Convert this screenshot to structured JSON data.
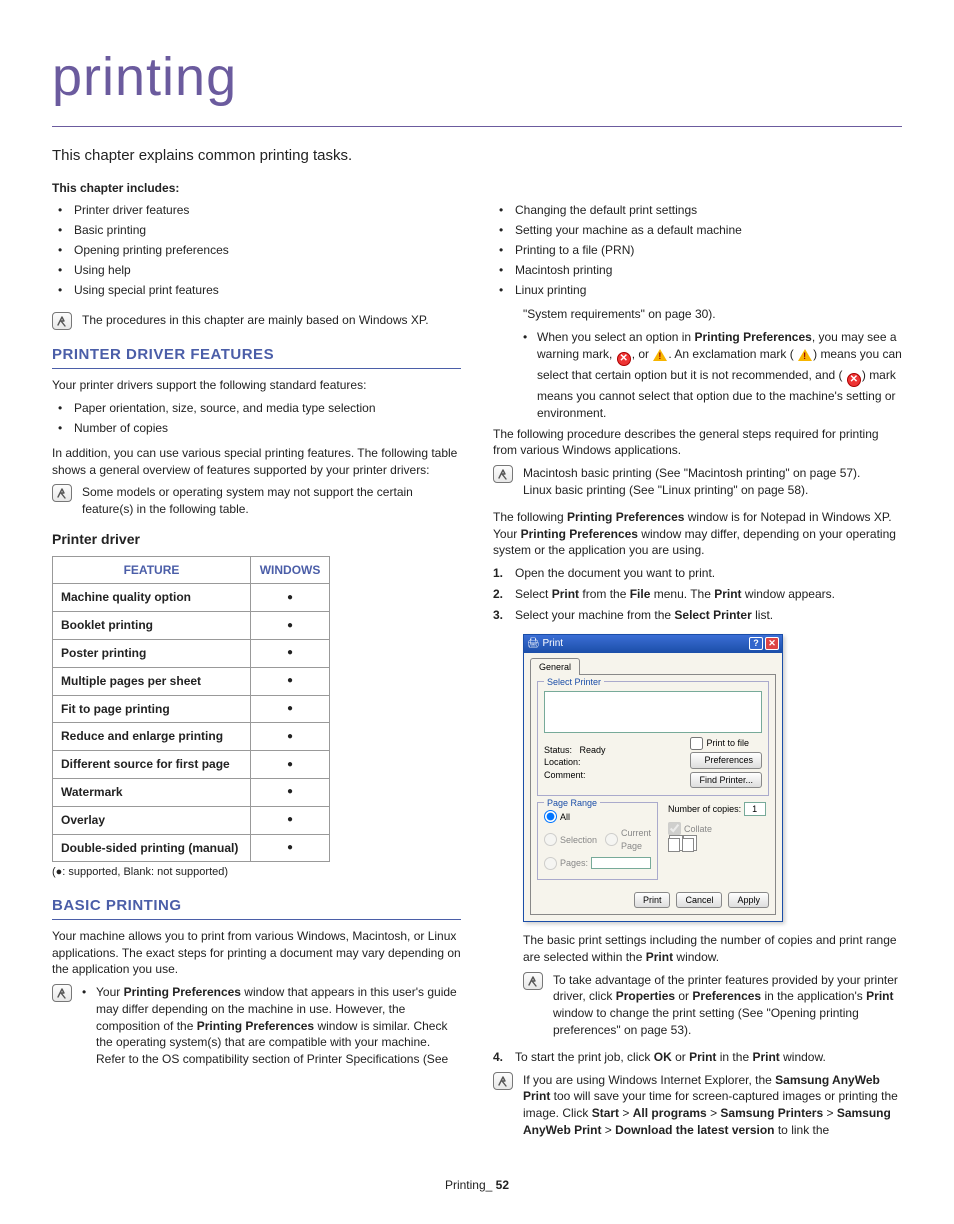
{
  "chapter": {
    "title": "printing",
    "intro": "This chapter explains common printing tasks.",
    "includes_head": "This chapter includes:"
  },
  "includes_left": [
    "Printer driver features",
    "Basic printing",
    "Opening printing preferences",
    "Using help",
    "Using special print features"
  ],
  "includes_right": [
    "Changing the default print settings",
    "Setting your machine as a default machine",
    "Printing to a file (PRN)",
    "Macintosh printing",
    "Linux printing"
  ],
  "note_xp": "The procedures in this chapter are mainly based on Windows XP.",
  "sections": {
    "driver_features": {
      "heading": "PRINTER DRIVER FEATURES",
      "p1": "Your printer drivers support the following standard features:",
      "bullets": [
        "Paper orientation, size, source, and media type selection",
        "Number of copies"
      ],
      "p2": "In addition, you can use various special printing features. The following table shows a general overview of features supported by your printer drivers:",
      "note": "Some models or operating system may not support the certain feature(s) in the following table.",
      "sub_heading": "Printer driver",
      "table": {
        "headers": [
          "FEATURE",
          "WINDOWS"
        ],
        "rows": [
          [
            "Machine quality option",
            "●"
          ],
          [
            "Booklet printing",
            "●"
          ],
          [
            "Poster printing",
            "●"
          ],
          [
            "Multiple pages per sheet",
            "●"
          ],
          [
            "Fit to page printing",
            "●"
          ],
          [
            "Reduce and enlarge printing",
            "●"
          ],
          [
            "Different source for first page",
            "●"
          ],
          [
            "Watermark",
            "●"
          ],
          [
            "Overlay",
            "●"
          ],
          [
            "Double-sided printing (manual)",
            "●"
          ]
        ],
        "note": "(●: supported, Blank: not supported)"
      }
    },
    "basic_printing": {
      "heading": "BASIC PRINTING",
      "p1": "Your machine allows you to print from various Windows, Macintosh, or Linux applications. The exact steps for printing a document may vary depending on the application you use.",
      "note1_parts": {
        "pre": "Your ",
        "b1": "Printing Preferences",
        "mid": " window that appears in this user's guide may differ depending on the machine in use. However, the composition of the ",
        "b2": "Printing Preferences",
        "post": " window is similar. Check the operating system(s) that are compatible with your machine. Refer to the OS compatibility section of Printer Specifications (See"
      },
      "sysreq": "\"System requirements\" on page 30).",
      "warn_parts": {
        "pre": "When you select an option in ",
        "b1": "Printing Preferences",
        "mid1": ", you may see a warning mark, ",
        "mid2": ", or ",
        "mid3": ". An exclamation mark (",
        "mid4": ") means you can select that certain option but it is not recommended, and (",
        "post": ") mark means you cannot select that option due to the machine's setting or environment."
      },
      "p2": "The following procedure describes the general steps required for printing from various Windows applications.",
      "note2_l1": "Macintosh basic printing (See \"Macintosh printing\" on page 57).",
      "note2_l2": "Linux basic printing (See \"Linux printing\" on page 58).",
      "p3_parts": {
        "pre": "The following ",
        "b1": "Printing Preferences",
        "mid": " window is for Notepad in Windows XP. Your ",
        "b2": "Printing Preferences",
        "post": " window may differ, depending on your operating system or the application you are using."
      },
      "steps": [
        {
          "n": "1.",
          "text": "Open the document you want to print."
        },
        {
          "n": "2.",
          "pre": "Select ",
          "b1": "Print",
          "mid1": " from the ",
          "b2": "File",
          "mid2": " menu. The ",
          "b3": "Print",
          "post": " window appears."
        },
        {
          "n": "3.",
          "pre": "Select your machine from the ",
          "b1": "Select Printer",
          "post": " list."
        }
      ],
      "p4_parts": {
        "pre": "The basic print settings including the number of copies and print range are selected within the ",
        "b1": "Print",
        "post": " window."
      },
      "note3_parts": {
        "pre": "To take advantage of the printer features provided by your printer driver, click ",
        "b1": "Properties",
        "mid1": " or ",
        "b2": "Preferences",
        "mid2": " in the application's ",
        "b3": "Print",
        "post": " window to change the print setting (See \"Opening printing preferences\" on page 53)."
      },
      "step4": {
        "n": "4.",
        "pre": "To start the print job, click ",
        "b1": "OK",
        "mid": " or ",
        "b2": "Print",
        "mid2": " in the ",
        "b3": "Print",
        "post": " window."
      },
      "note4_parts": {
        "pre": "If you are using Windows Internet Explorer, the ",
        "b1": "Samsung AnyWeb Print",
        "mid1": " too will save your time for screen-captured images or printing the image. Click ",
        "b2": "Start",
        "gt1": " > ",
        "b3": "All programs",
        "gt2": " > ",
        "b4": "Samsung Printers",
        "gt3": " > ",
        "b5": "Samsung AnyWeb Print",
        "gt4": " > ",
        "b6": "Download the latest version",
        "post": " to link the"
      }
    }
  },
  "print_dialog": {
    "title": "Print",
    "tab": "General",
    "group_select": "Select Printer",
    "status_lbl": "Status:",
    "status_val": "Ready",
    "location_lbl": "Location:",
    "comment_lbl": "Comment:",
    "print_to_file": "Print to file",
    "preferences": "Preferences",
    "find_printer": "Find Printer...",
    "group_range": "Page Range",
    "opt_all": "All",
    "opt_selection": "Selection",
    "opt_current": "Current Page",
    "opt_pages": "Pages:",
    "copies_lbl": "Number of copies:",
    "copies_val": "1",
    "collate": "Collate",
    "btn_print": "Print",
    "btn_cancel": "Cancel",
    "btn_apply": "Apply"
  },
  "footer": {
    "label": "Printing",
    "page": "52"
  }
}
